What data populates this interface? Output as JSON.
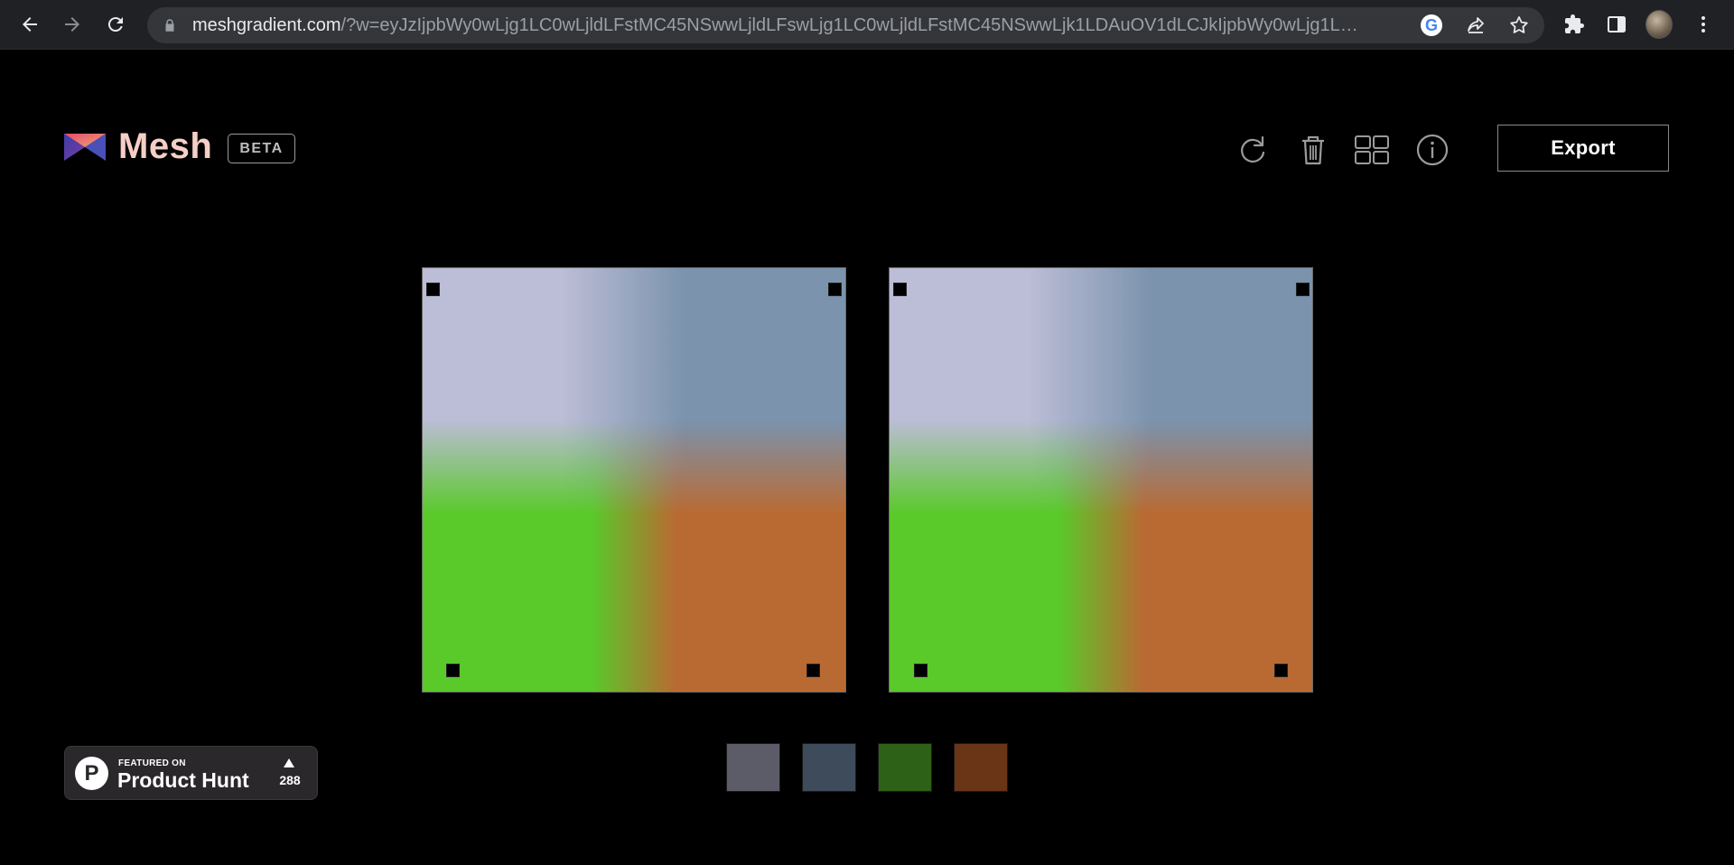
{
  "browser": {
    "url_host": "meshgradient.com",
    "url_rest": "/?w=eyJzIjpbWy0wLjg1LC0wLjldLFstMC45NSwwLjldLFswLjg1LC0wLjldLFstMC45NSwwLjk1LDAuOV1dLCJkIjpbWy0wLjg1LC0wLjldLFstMC4..."
  },
  "app": {
    "brand": "Mesh",
    "badge": "BETA",
    "export_label": "Export"
  },
  "toolbar_icons": [
    "refresh-icon",
    "trash-icon",
    "grid-icon",
    "info-icon"
  ],
  "gradient_colors": {
    "top_left": "#bcbdd6",
    "top_right": "#7b93ad",
    "bottom_left": "#5ac92a",
    "bottom_right": "#b96a32"
  },
  "palette": [
    {
      "name": "slate-gray",
      "color": "#5b5c68"
    },
    {
      "name": "steel-blue",
      "color": "#3e4b5b"
    },
    {
      "name": "forest-green",
      "color": "#2d6117"
    },
    {
      "name": "rust-brown",
      "color": "#6a3417"
    }
  ],
  "product_hunt": {
    "featured_on": "FEATURED ON",
    "name": "Product Hunt",
    "votes": "288",
    "logo_letter": "P"
  }
}
